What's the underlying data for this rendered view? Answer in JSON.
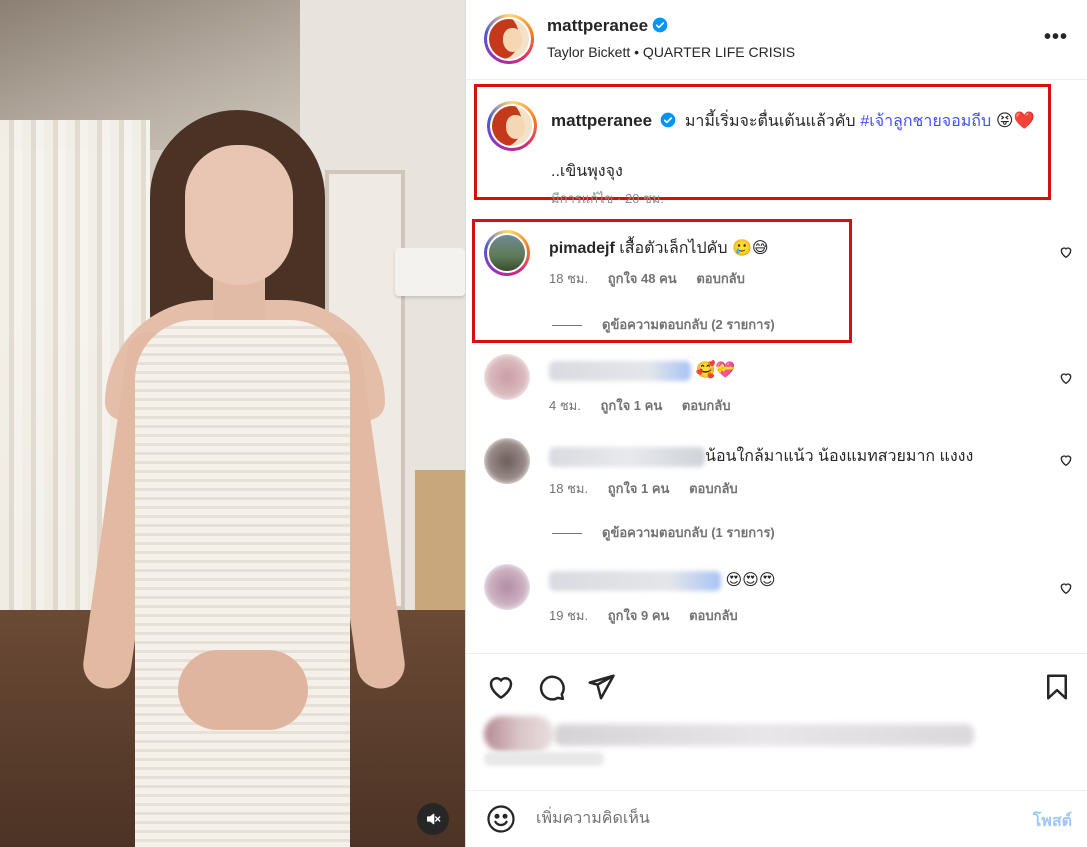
{
  "media": {
    "mute_icon": "speaker-muted-icon"
  },
  "header": {
    "username": "mattperanee",
    "audio": "Taylor Bickett • QUARTER LIFE CRISIS",
    "more_icon": "more-horizontal-icon",
    "more_label": "•••"
  },
  "caption": {
    "username": "mattperanee",
    "text": "มามี้เริ่มจะตื่นเต้นแล้วคับ",
    "hashtag": "#เจ้าลูกชายจอมถีบ",
    "emojis": "😝❤️",
    "second_line": "..เขินพุงจุง",
    "meta": "มีการแก้ไข · 20 ชม."
  },
  "comments": [
    {
      "username": "pimadejf",
      "text": "เสื้อตัวเล็กไปคับ 🥲😅",
      "time": "18 ชม.",
      "likes": "ถูกใจ 48 คน",
      "reply": "ตอบกลับ",
      "view_replies": "ดูข้อความตอบกลับ (2 รายการ)"
    },
    {
      "username": "",
      "text": "🥰💝",
      "time": "4 ชม.",
      "likes": "ถูกใจ 1 คน",
      "reply": "ตอบกลับ"
    },
    {
      "username": "",
      "text": "น้อนใกล้มาแน้ว น้องแมทสวยมาก แงงง",
      "time": "18 ชม.",
      "likes": "ถูกใจ 1 คน",
      "reply": "ตอบกลับ",
      "view_replies": "ดูข้อความตอบกลับ (1 รายการ)"
    },
    {
      "username": "",
      "text": "😍😍😍",
      "time": "19 ชม.",
      "likes": "ถูกใจ 9 คน",
      "reply": "ตอบกลับ"
    }
  ],
  "actions": {
    "like_icon": "heart-icon",
    "comment_icon": "comment-icon",
    "share_icon": "send-icon",
    "save_icon": "bookmark-icon"
  },
  "comment_bar": {
    "placeholder": "เพิ่มความคิดเห็น",
    "post_label": "โพสต์"
  },
  "colors": {
    "highlight_border": "#d70f0f",
    "hashtag": "#4150f7",
    "verified": "#0095f6",
    "post_button": "#9fc8f7"
  }
}
